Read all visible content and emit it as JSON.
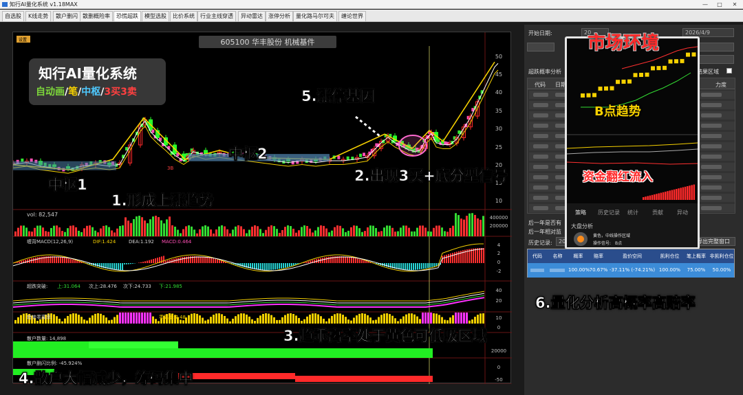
{
  "window": {
    "title": "知行AI量化系统 v1.18MAX",
    "minimize": "—",
    "maximize": "□",
    "close": "✕"
  },
  "tabs": [
    "自选股",
    "K线走势",
    "散户删闪",
    "散删概险率",
    "恐慌超跌",
    "模型选股",
    "比价系统",
    "行业主线穿透",
    "异动雷达",
    "涨停分析",
    "量化路马尔可夫",
    "缠论世界"
  ],
  "active_tab_index": 4,
  "chart": {
    "setting_button": "设置",
    "stock_title": "605100 华丰股份 机械基件",
    "price_axis": [
      "50",
      "45",
      "40",
      "35",
      "30",
      "25",
      "20",
      "15",
      "10"
    ],
    "vol_label": "vol: 82,547",
    "vol_axis": [
      "400000",
      "200000"
    ],
    "macd_label": "缠背MACD(12,26,9)",
    "macd_dif": "DIF:1.424",
    "macd_dea": "DEA:1.192",
    "macd_val": "MACD:0.464",
    "macd_axis": [
      "4",
      "2",
      "0",
      "-2"
    ],
    "breakout_label": "超跌突破:",
    "breakout_up": "上:31.064",
    "breakout_next_up": "次上:28.476",
    "breakout_next_down": "次下:24.733",
    "breakout_down": "下:21.985",
    "breakout_axis": [
      "40",
      "20"
    ],
    "trend_label": "趋势乖离率:",
    "trend_value": "乖离率:7.48",
    "trend_axis": [
      "10",
      "0"
    ],
    "retail_label": "散户数量: 14,898",
    "retail_axis": [
      "20000"
    ],
    "retail_ratio_label": "散户删闪比例: -45.924%",
    "retail_ratio_axis": [
      "0",
      "-50"
    ],
    "tag_3b": "3B"
  },
  "brand": {
    "title": "知行AI量化系统",
    "sub_1": "自动画",
    "sep_1": "/",
    "sub_2": "笔",
    "sep_2": "/",
    "sub_3": "中枢",
    "sep_3": "/",
    "sub_4": "3买3卖"
  },
  "annotations": {
    "pivot1": "中枢1",
    "pivot2": "中枢2",
    "a1": "1.形成上涨趋势",
    "a2": "2.出现3买+底分型信号",
    "a3": "3.趋乖离率处于黄色可低吸区域",
    "a4": "4.散户大幅减少，筹码集中",
    "a5": "5.涨停基因",
    "a6": "6.量化分析高概率高赔率",
    "market": "市场环境",
    "bpoint": "B点趋势",
    "fund": "资金翻红流入"
  },
  "right_panel": {
    "start_date_label": "开始日期:",
    "start_date_value": "20",
    "end_date_value": "2026/4/9",
    "overfall_label": "超跌概率分析",
    "result_area_label": "结果区域",
    "col_1": "代码",
    "col_2": "日期",
    "col_strength": "力度",
    "year_yes": "后一年是否有",
    "year_rel": "后一年相对监",
    "history_label": "历史记录:",
    "history_value": "20",
    "export_button": "导出完整窗口"
  },
  "phone": {
    "tab_strategy": "策略",
    "tab_history": "历史记录",
    "tab_stats": "统计",
    "tab_contrib": "贡献",
    "tab_anomaly": "异动",
    "market_analysis": "大盘分析",
    "advice": "黄色，中线操作区域",
    "op_label": "操作信号:",
    "op_value": "B点"
  },
  "result_table": {
    "headers": [
      "代码",
      "名称",
      "概率",
      "赔率",
      "盈价空间",
      "凯利仓位",
      "笔上概率",
      "非凯利仓位"
    ],
    "row": [
      "",
      "",
      "100.00%",
      "70.67%",
      "-37.11% (-74.21%)",
      "100.00%",
      "75.00%",
      "50.00%"
    ]
  },
  "colors": {
    "up": "#ff2a2a",
    "down": "#2aff2a",
    "pivot_box": "#4d7fa8",
    "yellow": "#f5d000",
    "magenta": "#ff33ff",
    "cyan": "#27d3d3"
  }
}
